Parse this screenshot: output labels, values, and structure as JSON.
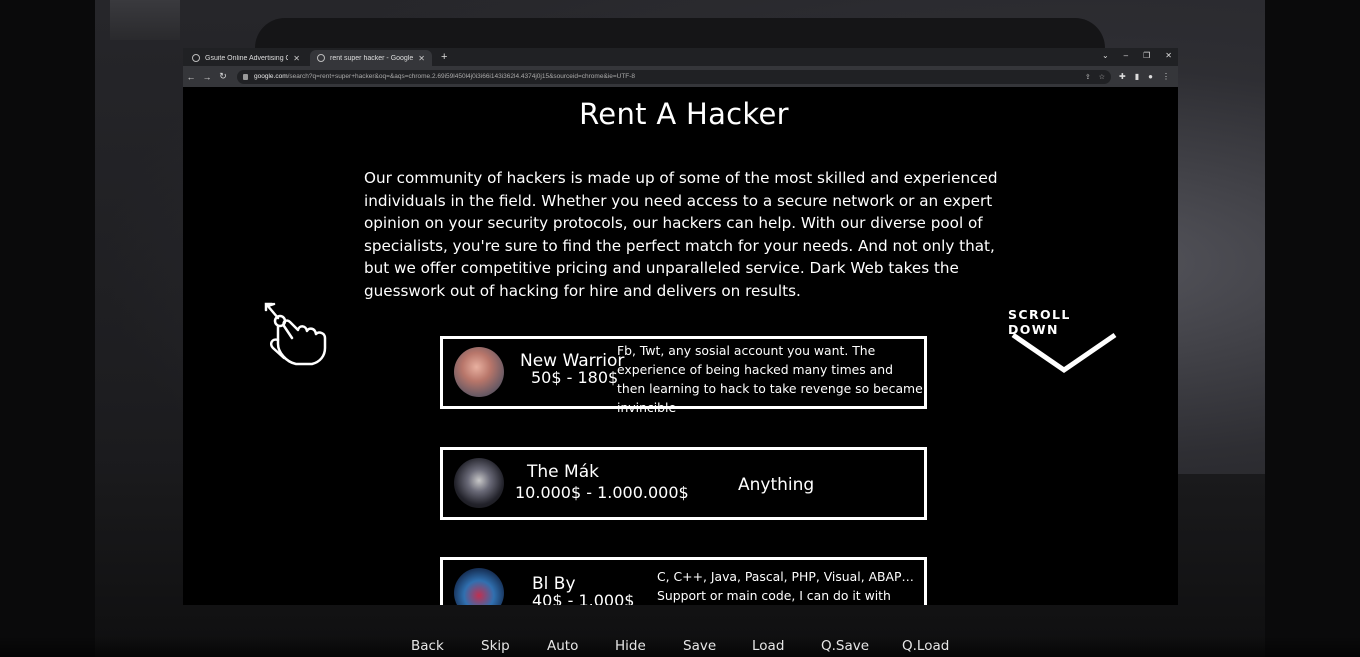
{
  "browser": {
    "tabs": [
      {
        "title": "Gsuite Online Advertising Collab",
        "active": false
      },
      {
        "title": "rent super hacker - Google Search",
        "active": true
      }
    ],
    "new_tab_symbol": "+",
    "window_controls": [
      "⌄",
      "–",
      "❐",
      "✕"
    ],
    "url_host": "google.com",
    "url_path": "/search?q=rent+super+hacker&oq=&aqs=chrome.2.69i59l450l4j0i3i66i143i362l4.4374j0j15&sourceid=chrome&ie=UTF-8"
  },
  "page": {
    "title": "Rent A Hacker",
    "intro": "Our community of hackers is made up of some of the most skilled and experienced individuals in the field. Whether you need access to a secure network or an expert opinion on your security protocols, our hackers can help. With our diverse pool of specialists, you're sure to find the perfect match for your needs. And not only that, but we offer competitive pricing and unparalleled service. Dark Web takes the guesswork out of hacking for hire and delivers on results.",
    "hackers": [
      {
        "name": "New Warrior",
        "price": "50$ - 180$",
        "description": "Fb, Twt, any sosial account you want. The experience of being hacked many times and then learning to hack to take revenge so became invincible"
      },
      {
        "name": "The Mák",
        "price": "10.000$ - 1.000.000$",
        "description": "Anything"
      },
      {
        "name": "Bl By",
        "price": "40$ - 1.000$",
        "description": "C, C++, Java, Pascal, PHP, Visual, ABAP… Support or main code, I can do it with"
      }
    ]
  },
  "overlay": {
    "scroll_hint": "SCROLL DOWN",
    "hand_icon": "tap-hand-icon"
  },
  "quick_menu": {
    "items": [
      "Back",
      "Skip",
      "Auto",
      "Hide",
      "Save",
      "Load",
      "Q.Save",
      "Q.Load"
    ]
  },
  "colors": {
    "page_background": "#000000",
    "text": "#ffffff",
    "card_border": "#ffffff",
    "tabbar": "#202124",
    "toolbar": "#35363a"
  }
}
